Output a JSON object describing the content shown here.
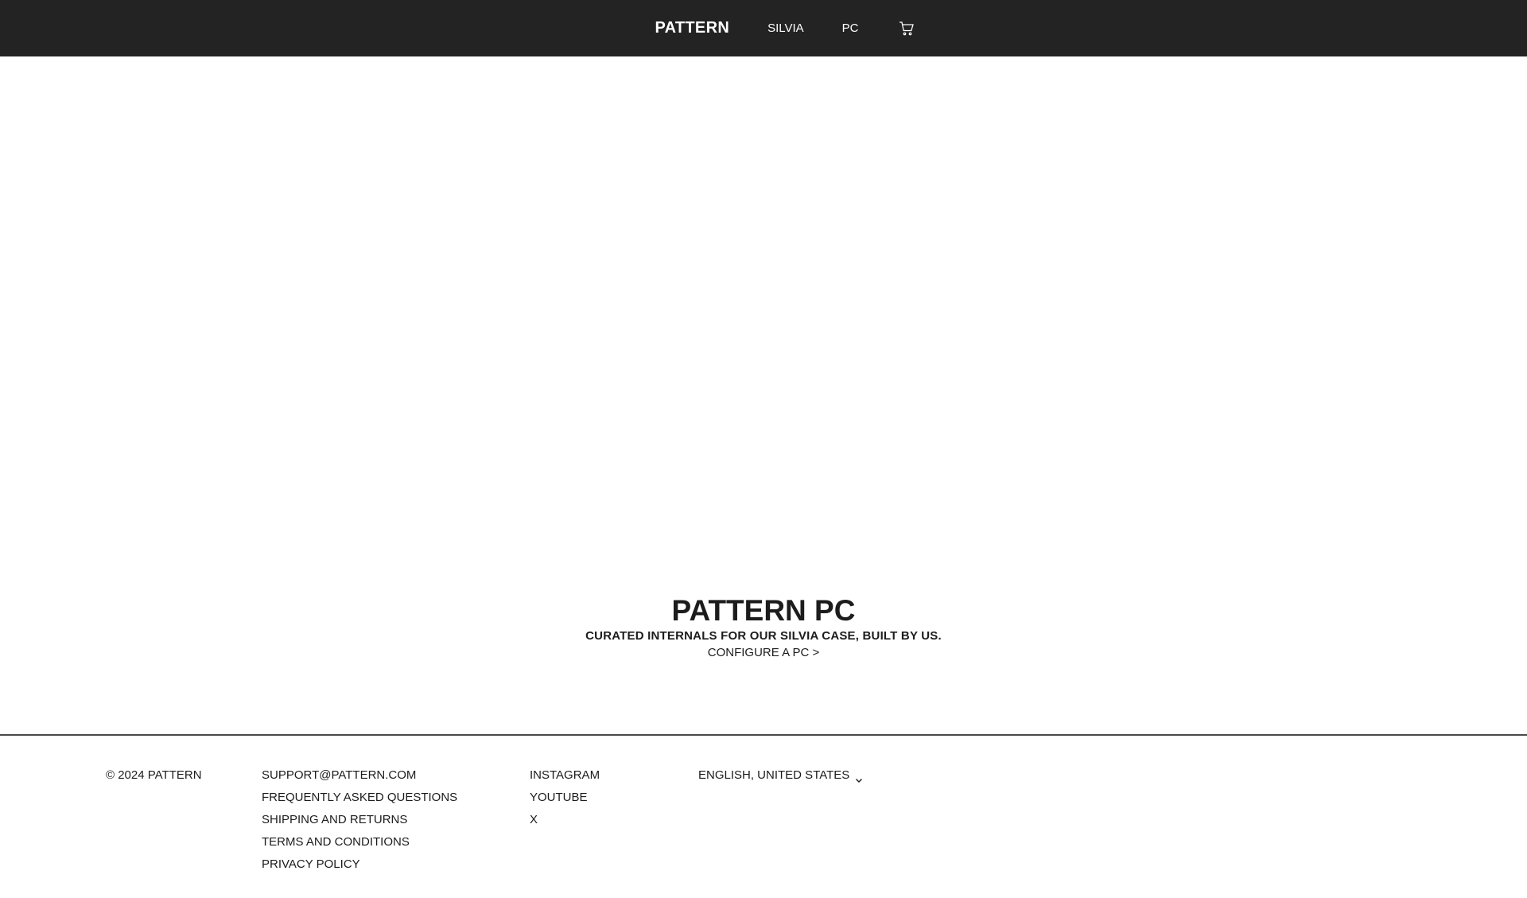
{
  "nav": {
    "brand": "PATTERN",
    "links": [
      "SILVIA",
      "PC"
    ],
    "cart_icon": "cart-icon",
    "background": "#232323"
  },
  "hero": {
    "title": "PATTERN PC",
    "subtitle": "CURATED INTERNALS FOR OUR SILVIA CASE, BUILT BY US.",
    "cta": "CONFIGURE A PC >"
  },
  "footer": {
    "copyright": "© 2024 PATTERN",
    "help_links": [
      "SUPPORT@PATTERN.COM",
      "FREQUENTLY ASKED QUESTIONS",
      "SHIPPING AND RETURNS",
      "TERMS AND CONDITIONS",
      "PRIVACY POLICY"
    ],
    "social_links": [
      "INSTAGRAM",
      "YOUTUBE",
      "X"
    ],
    "language": {
      "selected": "ENGLISH, UNITED STATES",
      "icon": "chevron-down-icon"
    }
  }
}
